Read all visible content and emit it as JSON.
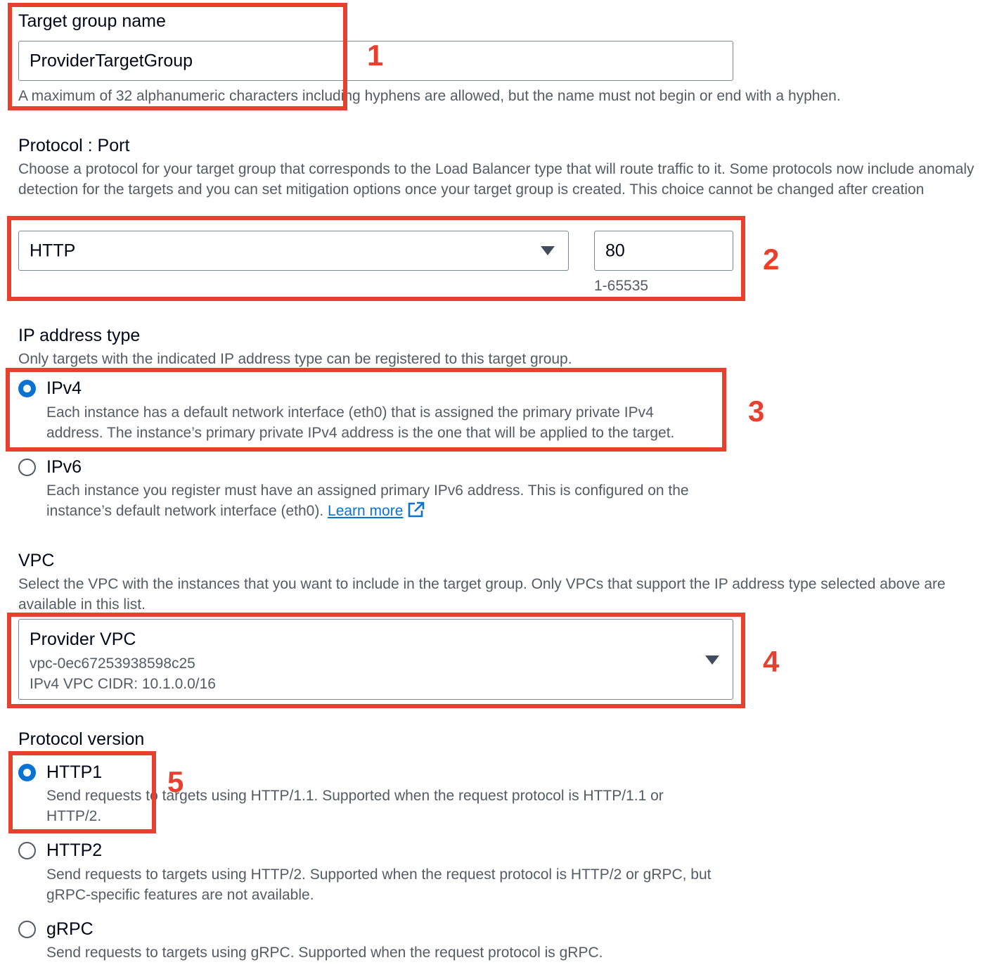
{
  "target_group_name": {
    "label": "Target group name",
    "value": "ProviderTargetGroup",
    "hint": "A maximum of 32 alphanumeric characters including hyphens are allowed, but the name must not begin or end with a hyphen."
  },
  "protocol_port": {
    "label": "Protocol : Port",
    "description": "Choose a protocol for your target group that corresponds to the Load Balancer type that will route traffic to it. Some protocols now include anomaly detection for the targets and you can set mitigation options once your target group is created. This choice cannot be changed after creation",
    "protocol_value": "HTTP",
    "port_value": "80",
    "port_hint": "1-65535"
  },
  "ip_address_type": {
    "label": "IP address type",
    "description": "Only targets with the indicated IP address type can be registered to this target group.",
    "options": [
      {
        "label": "IPv4",
        "description": "Each instance has a default network interface (eth0) that is assigned the primary private IPv4 address. The instance’s primary private IPv4 address is the one that will be applied to the target.",
        "selected": true
      },
      {
        "label": "IPv6",
        "description": "Each instance you register must have an assigned primary IPv6 address. This is configured on the instance’s default network interface (eth0).",
        "link_text": "Learn more",
        "selected": false
      }
    ]
  },
  "vpc": {
    "label": "VPC",
    "description": "Select the VPC with the instances that you want to include in the target group. Only VPCs that support the IP address type selected above are available in this list.",
    "selected_name": "Provider VPC",
    "selected_id": "vpc-0ec67253938598c25",
    "selected_cidr": "IPv4 VPC CIDR: 10.1.0.0/16"
  },
  "protocol_version": {
    "label": "Protocol version",
    "options": [
      {
        "label": "HTTP1",
        "description": "Send requests to targets using HTTP/1.1. Supported when the request protocol is HTTP/1.1 or HTTP/2.",
        "selected": true
      },
      {
        "label": "HTTP2",
        "description": "Send requests to targets using HTTP/2. Supported when the request protocol is HTTP/2 or gRPC, but gRPC-specific features are not available.",
        "selected": false
      },
      {
        "label": "gRPC",
        "description": "Send requests to targets using gRPC. Supported when the request protocol is gRPC.",
        "selected": false
      }
    ]
  },
  "callouts": [
    "1",
    "2",
    "3",
    "4",
    "5"
  ],
  "colors": {
    "callout": "#e8402e",
    "radio_selected": "#0972d3",
    "link": "#0972d3"
  },
  "icons": {
    "dropdown": "caret-down-icon",
    "external_link": "external-link-icon"
  }
}
